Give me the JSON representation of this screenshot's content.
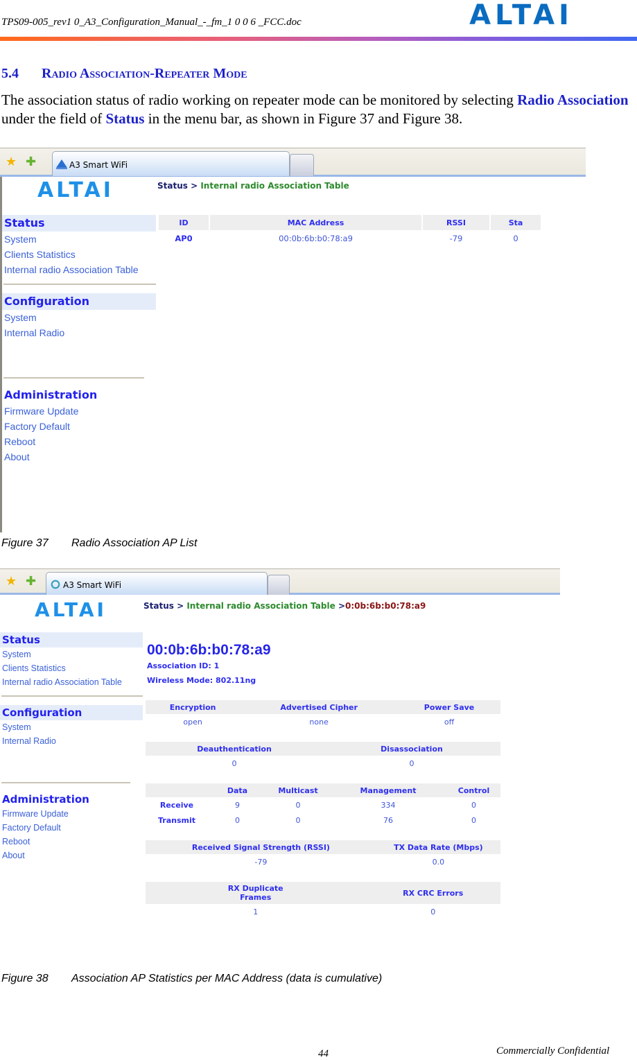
{
  "document": {
    "header_filename": "TPS09-005_rev1 0_A3_Configuration_Manual_-_fm_1 0 0 6 _FCC.doc",
    "brand_logo_text": "ALTAI",
    "section": {
      "number": "5.4",
      "title": "Radio Association-Repeater Mode"
    },
    "paragraph": {
      "part1": "The association status of radio working on repeater mode can be monitored by selecting ",
      "bold1": "Radio Association",
      "part2": " under the field of ",
      "bold2": "Status",
      "part3": " in the menu bar, as shown in Figure 37 and Figure 38."
    },
    "footer": {
      "page_number": "44",
      "confidentiality": "Commercially Confidential"
    },
    "colors": {
      "heading_blue": "#1d22c8",
      "nav_blue": "#3a60d8",
      "gradient_start": "#ff6a1a",
      "gradient_end": "#3f68f2"
    }
  },
  "figure37": {
    "caption_number": "Figure 37",
    "caption_text": "Radio Association AP List",
    "browser": {
      "tab_title": "A3 Smart WiFi",
      "bookmark_icon": "star-icon",
      "add_bookmark_icon": "add-star-icon"
    },
    "app_logo_text": "ALTAI",
    "breadcrumb": {
      "root": "Status",
      "separator": ">",
      "current": "Internal radio Association Table"
    },
    "nav": {
      "status_heading": "Status",
      "status_items": [
        "System",
        "Clients Statistics",
        "Internal radio Association Table"
      ],
      "config_heading": "Configuration",
      "config_items": [
        "System",
        "Internal Radio"
      ],
      "admin_heading": "Administration",
      "admin_items": [
        "Firmware Update",
        "Factory Default",
        "Reboot",
        "About"
      ]
    },
    "ap_table": {
      "columns": [
        "ID",
        "MAC Address",
        "RSSI",
        "Sta"
      ],
      "rows": [
        [
          "AP0",
          "00:0b:6b:b0:78:a9",
          "-79",
          "0"
        ]
      ]
    }
  },
  "figure38": {
    "caption_number": "Figure 38",
    "caption_text": "Association AP Statistics per MAC Address (data is cumulative)",
    "browser": {
      "tab_title": "A3 Smart WiFi"
    },
    "app_logo_text": "ALTAI",
    "breadcrumb": {
      "root": "Status",
      "separator": ">",
      "middle": "Internal radio Association Table",
      "separator2": ">",
      "current": "0:0b:6b:b0:78:a9"
    },
    "nav": {
      "status_heading": "Status",
      "status_items": [
        "System",
        "Clients Statistics",
        "Internal radio Association Table"
      ],
      "config_heading": "Configuration",
      "config_items": [
        "System",
        "Internal Radio"
      ],
      "admin_heading": "Administration",
      "admin_items": [
        "Firmware Update",
        "Factory Default",
        "Reboot",
        "About"
      ]
    },
    "detail": {
      "mac": "00:0b:6b:b0:78:a9",
      "association_id": "Association ID: 1",
      "wireless_mode": "Wireless Mode: 802.11ng",
      "security": {
        "columns": [
          "Encryption",
          "Advertised Cipher",
          "Power Save"
        ],
        "values": [
          "open",
          "none",
          "off"
        ]
      },
      "auth": {
        "columns": [
          "Deauthentication",
          "Disassociation"
        ],
        "values": [
          "0",
          "0"
        ]
      },
      "frames": {
        "columns": [
          "",
          "Data",
          "Multicast",
          "Management",
          "Control"
        ],
        "rows": [
          [
            "Receive",
            "9",
            "0",
            "334",
            "0"
          ],
          [
            "Transmit",
            "0",
            "0",
            "76",
            "0"
          ]
        ]
      },
      "signal": {
        "columns": [
          "Received Signal Strength (RSSI)",
          "TX Data Rate (Mbps)"
        ],
        "values": [
          "-79",
          "0.0"
        ]
      },
      "errors": {
        "columns": [
          "RX Duplicate Frames",
          "RX CRC Errors"
        ],
        "values": [
          "1",
          "0"
        ]
      }
    }
  }
}
